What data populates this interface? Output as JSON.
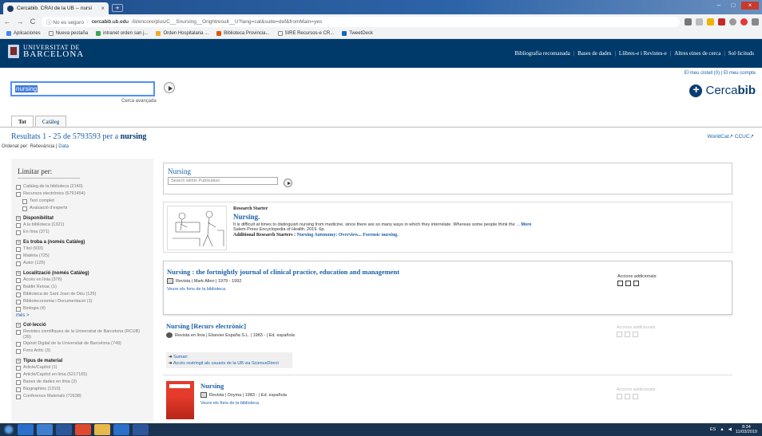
{
  "browser": {
    "tab_title": "Cercabib. CRAI de la UB -- nursi",
    "tab_close": "×",
    "new_tab": "+",
    "back": "←",
    "forward": "→",
    "reload": "C",
    "secure_label": "ⓘ No es seguro",
    "url_domain": "cercabib.ub.edu",
    "url_path": "/iii/encore/plus/C__Snursing__Orightresult__U?lang=cat&suite=def&fromMain=yes",
    "bookmarks": [
      "Aplicaciones",
      "Nueva pestaña",
      "intranet orden san j...",
      "Orden Hospitalaria ...",
      "Biblioteca Provincia...",
      "SIRE Recursos-e CR...",
      "TweetDeck"
    ]
  },
  "header": {
    "logo_line1": "UNIVERSITAT DE",
    "logo_line2": "BARCELONA",
    "nav": [
      "Bibliografia recomanada",
      "Bases de dades",
      "Llibres-e i Revistes-e",
      "Altres eines de cerca",
      "Sol·licituds"
    ],
    "nav_sep": "|",
    "user_links": "El meu cistell (0) | El meu compte"
  },
  "search": {
    "query": "nursing",
    "advanced": "Cerca avançada"
  },
  "brand": {
    "name_plain": "Cerca",
    "name_bold": "bib"
  },
  "tabs": [
    "Tot",
    "Catàleg"
  ],
  "results": {
    "prefix": "Resultats 1 - 25 de 5793593 per a",
    "term": "nursing",
    "worldcat": "WorldCat↗  CCUC↗",
    "sort_label": "Ordenat per: Rellevància |",
    "sort_alt": "Data"
  },
  "facets": {
    "title": "Limitar per:",
    "top": [
      {
        "label": "Catàleg de la biblioteca (2140)"
      },
      {
        "label": "Recursos electrònics (5791454)"
      }
    ],
    "top_sub": [
      {
        "label": "Text complet"
      },
      {
        "label": "Avaluació d'experts"
      }
    ],
    "groups": [
      {
        "name": "Disponibilitat",
        "items": [
          "A la biblioteca (1321)",
          "En línia (371)"
        ]
      },
      {
        "name": "Es troba a (només Catàleg)",
        "items": [
          "Títol (933)",
          "Matèria (725)",
          "Autor (125)"
        ]
      },
      {
        "name": "Localització (només Catàleg)",
        "items": [
          "Accés en línia (376)",
          "Baldiri Reixac (1)",
          "Biblioteca de Sant Joan de Déu (125)",
          "Biblioteconomia i Documentació (1)",
          "Biologia (4)"
        ],
        "more": "més >"
      },
      {
        "name": "Col·lecció",
        "items": [
          "Revistes científiques de la Universitat de Barcelona (RCUB) (39)",
          "Dipòsit Digital de la Universitat de Barcelona (749)",
          "Fons Antic (3)"
        ]
      },
      {
        "name": "Tipus de material",
        "items": [
          "Article/Capítol (1)",
          "Article/Capítol en línia (5217165)",
          "Bases de dades en línia (2)",
          "Biographies (1310)",
          "Conference Materials (72638)"
        ]
      }
    ]
  },
  "publication": {
    "title": "Nursing",
    "search_placeholder": "Search within Publication"
  },
  "research": {
    "label": "Research Starter",
    "title": "Nursing.",
    "desc": "It is difficult at times to distinguish nursing from medicine, since there are so many ways in which they interrelate. Whereas some people think the ...",
    "more": "More",
    "source": "Salem Press Encyclopedia of Health. 2019. 6p.",
    "addl_label": "Additional Research Starters :",
    "addl_links": "Nursing Autonomy: Overview... Forensic nursing."
  },
  "records": [
    {
      "title": "Nursing : the fortnightly journal of clinical practice, education and management",
      "meta": "Revista  |  Mark Allen  |  1979 - 1992",
      "link": "Veure els fons de la biblioteca",
      "actions": "Accions addicionals:"
    },
    {
      "title": "Nursing [Recurs electrònic]",
      "meta": "Revista en línia  |  Elsevier España S.L.  |  1983 -  |  Ed. española",
      "access1": "Sumari",
      "access2": "Accés restringit als usuaris de la UB via ScienceDirect",
      "actions": "Accions addicionals:"
    },
    {
      "title": "Nursing",
      "meta": "Revista  |  Doyma  |  1983 -  |  Ed. española",
      "link": "Veure els fons de la biblioteca",
      "actions": "Accions addicionals:"
    }
  ],
  "tray": {
    "lang": "ES",
    "time": "8:34",
    "date": "11/03/2019"
  },
  "colors": {
    "uni_blue": "#003a6b",
    "link_blue": "#1b5fa8"
  }
}
